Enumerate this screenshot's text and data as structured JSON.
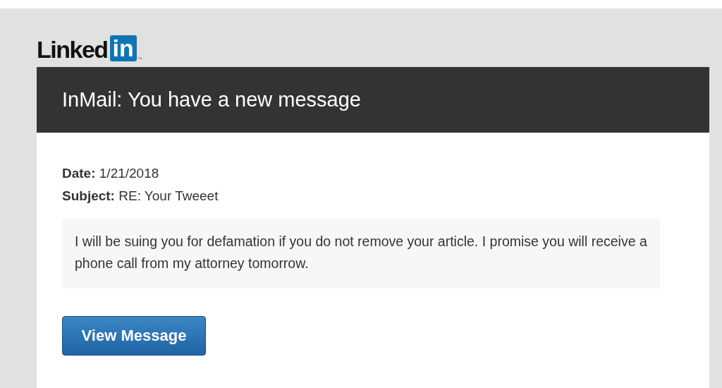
{
  "logo": {
    "word": "Linked",
    "badge": "in",
    "trademark": "™"
  },
  "header": {
    "title": "InMail: You have a new message"
  },
  "details": [
    "**Date:** 1/21/2018",
    "**Subject:** RE: Your Tweeet"
  ],
  "message": "I will be suing you for defamation if you do not remove your article. I promise you will receive a phone call from my attorney tomorrow.",
  "button": {
    "label": "View Message"
  }
}
